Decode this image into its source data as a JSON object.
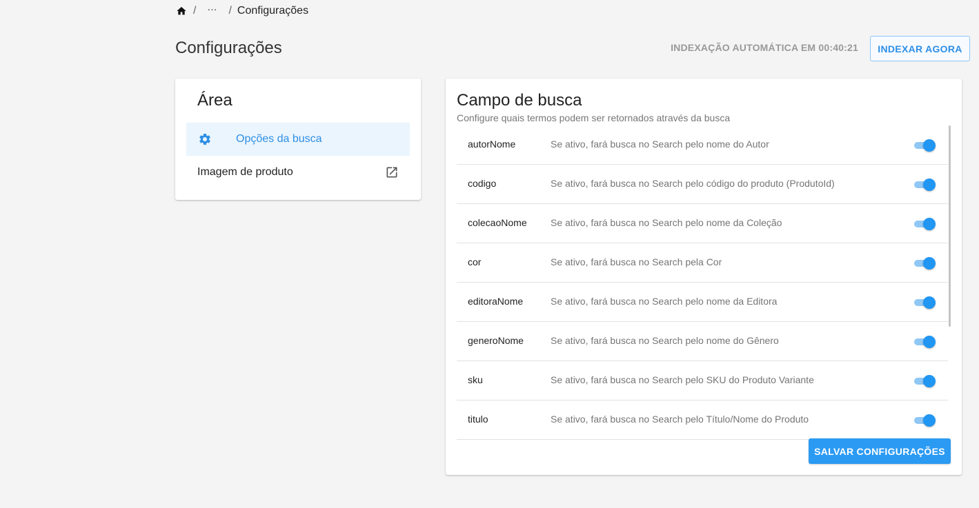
{
  "breadcrumb": {
    "separator": "/",
    "ellipsis": "···",
    "current": "Configurações"
  },
  "header": {
    "title": "Configurações",
    "auto_index_text": "INDEXAÇÃO AUTOMÁTICA EM 00:40:21",
    "index_now_label": "INDEXAR AGORA"
  },
  "area": {
    "title": "Área",
    "items": [
      {
        "label": "Opções da busca",
        "icon": "gear-icon",
        "active": true
      },
      {
        "label": "Imagem de produto",
        "icon": "open-in-new-icon",
        "active": false
      }
    ]
  },
  "search_field": {
    "title": "Campo de busca",
    "subtitle": "Configure quais termos podem ser retornados através da busca",
    "rows": [
      {
        "name": "autorNome",
        "description": "Se ativo, fará busca no Search pelo nome do Autor",
        "enabled": true
      },
      {
        "name": "codigo",
        "description": "Se ativo, fará busca no Search pelo código do produto (ProdutoId)",
        "enabled": true
      },
      {
        "name": "colecaoNome",
        "description": "Se ativo, fará busca no Search pelo nome da Coleção",
        "enabled": true
      },
      {
        "name": "cor",
        "description": "Se ativo, fará busca no Search pela Cor",
        "enabled": true
      },
      {
        "name": "editoraNome",
        "description": "Se ativo, fará busca no Search pelo nome da Editora",
        "enabled": true
      },
      {
        "name": "generoNome",
        "description": "Se ativo, fará busca no Search pelo nome do Gênero",
        "enabled": true
      },
      {
        "name": "sku",
        "description": "Se ativo, fará busca no Search pelo SKU do Produto Variante",
        "enabled": true
      },
      {
        "name": "titulo",
        "description": "Se ativo, fará busca no Search pelo Título/Nome do Produto",
        "enabled": true
      }
    ],
    "save_label": "SALVAR CONFIGURAÇÕES"
  },
  "colors": {
    "accent": "#2196f3",
    "accent_light": "#8fc7f5",
    "active_bg": "#ebf5fd",
    "page_bg": "#f4f4f4"
  }
}
